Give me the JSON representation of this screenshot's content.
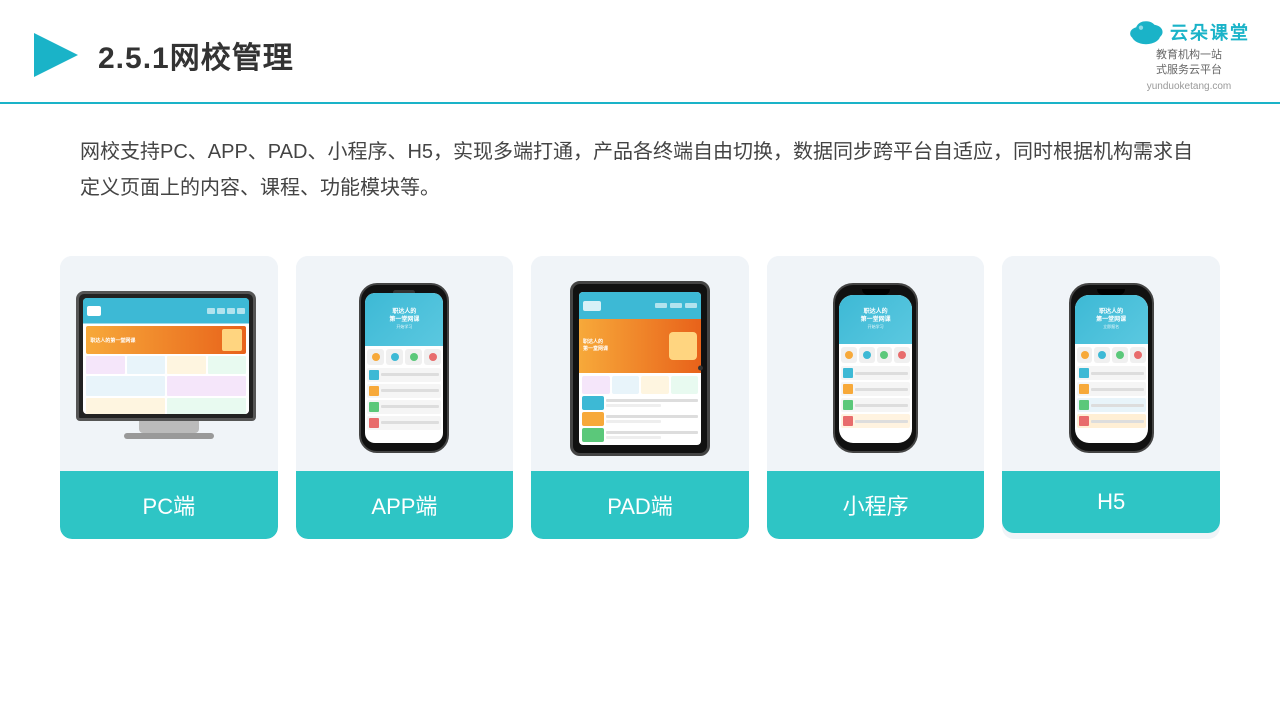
{
  "header": {
    "title": "2.5.1网校管理",
    "logo_name": "云朵课堂",
    "logo_url": "yunduoketang.com",
    "logo_tagline": "教育机构一站\n式服务云平台"
  },
  "description": {
    "text": "网校支持PC、APP、PAD、小程序、H5，实现多端打通，产品各终端自由切换，数据同步跨平台自适应，同时根据机构需求自定义页面上的内容、课程、功能模块等。"
  },
  "cards": [
    {
      "label": "PC端",
      "type": "pc"
    },
    {
      "label": "APP端",
      "type": "phone"
    },
    {
      "label": "PAD端",
      "type": "tablet"
    },
    {
      "label": "小程序",
      "type": "phone_notch"
    },
    {
      "label": "H5",
      "type": "phone_notch2"
    }
  ],
  "colors": {
    "accent": "#2ec5c5",
    "header_line": "#1ab3c8",
    "bg_card": "#f0f4f8",
    "text_main": "#444",
    "title": "#333"
  },
  "icons": {
    "play": "▶",
    "cloud": "☁"
  }
}
